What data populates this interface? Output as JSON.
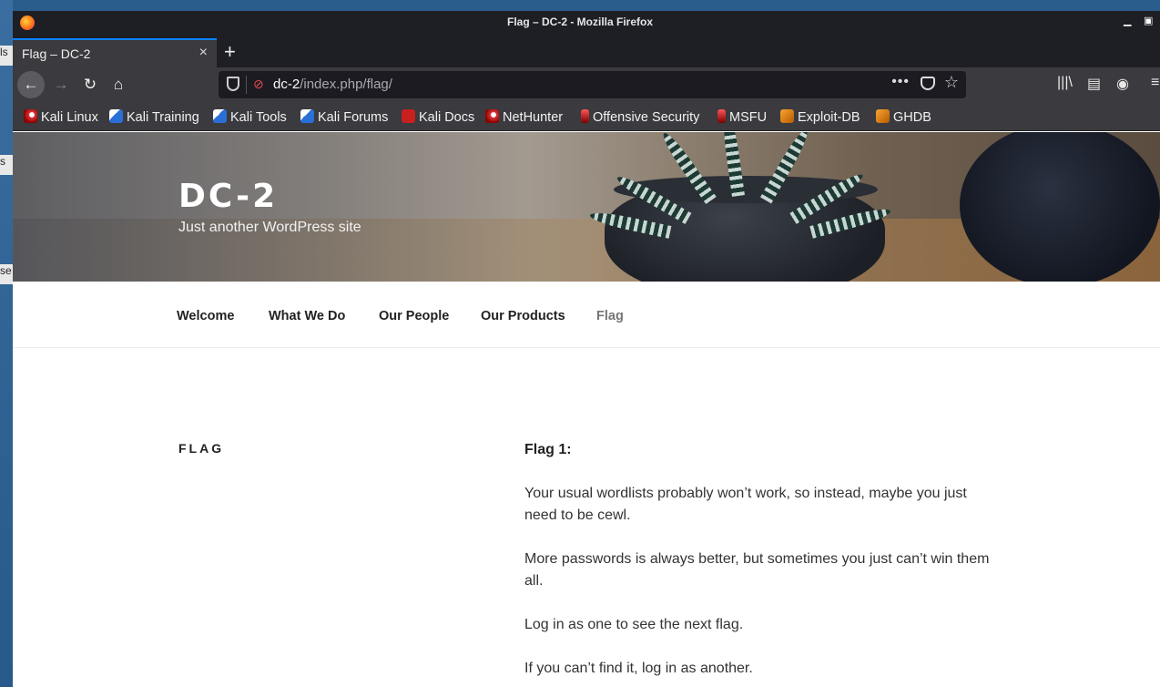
{
  "window": {
    "title": "Flag – DC-2 - Mozilla Firefox"
  },
  "tab": {
    "title": "Flag – DC-2",
    "close": "×",
    "new_tab": "+"
  },
  "nav": {
    "back": "←",
    "forward": "→",
    "reload": "↻",
    "home": "⌂"
  },
  "url": {
    "host": "dc-2",
    "path": "/index.php/flag/",
    "more": "•••",
    "star": "☆"
  },
  "bookmarks": [
    {
      "label": "Kali Linux",
      "icon": "kali-icon"
    },
    {
      "label": "Kali Training",
      "icon": "kali-training-icon"
    },
    {
      "label": "Kali Tools",
      "icon": "kali-tools-icon"
    },
    {
      "label": "Kali Forums",
      "icon": "kali-forums-icon"
    },
    {
      "label": "Kali Docs",
      "icon": "kali-docs-icon"
    },
    {
      "label": "NetHunter",
      "icon": "nethunter-icon"
    },
    {
      "label": "Offensive Security",
      "icon": "offsec-icon"
    },
    {
      "label": "MSFU",
      "icon": "msfu-icon"
    },
    {
      "label": "Exploit-DB",
      "icon": "exploitdb-icon"
    },
    {
      "label": "GHDB",
      "icon": "ghdb-icon"
    }
  ],
  "site": {
    "title": "DC-2",
    "tagline": "Just another WordPress site"
  },
  "menu": [
    "Welcome",
    "What We Do",
    "Our People",
    "Our Products",
    "Flag"
  ],
  "entry": {
    "title": "FLAG",
    "paragraphs": [
      "Flag 1:",
      "Your usual wordlists probably won’t work, so instead, maybe you just need to be cewl.",
      "More passwords is always better, but sometimes you just can’t win them all.",
      "Log in as one to see the next flag.",
      "If you can’t find it, log in as another."
    ]
  },
  "desktop_fragments": [
    "ls",
    "s",
    "se"
  ]
}
